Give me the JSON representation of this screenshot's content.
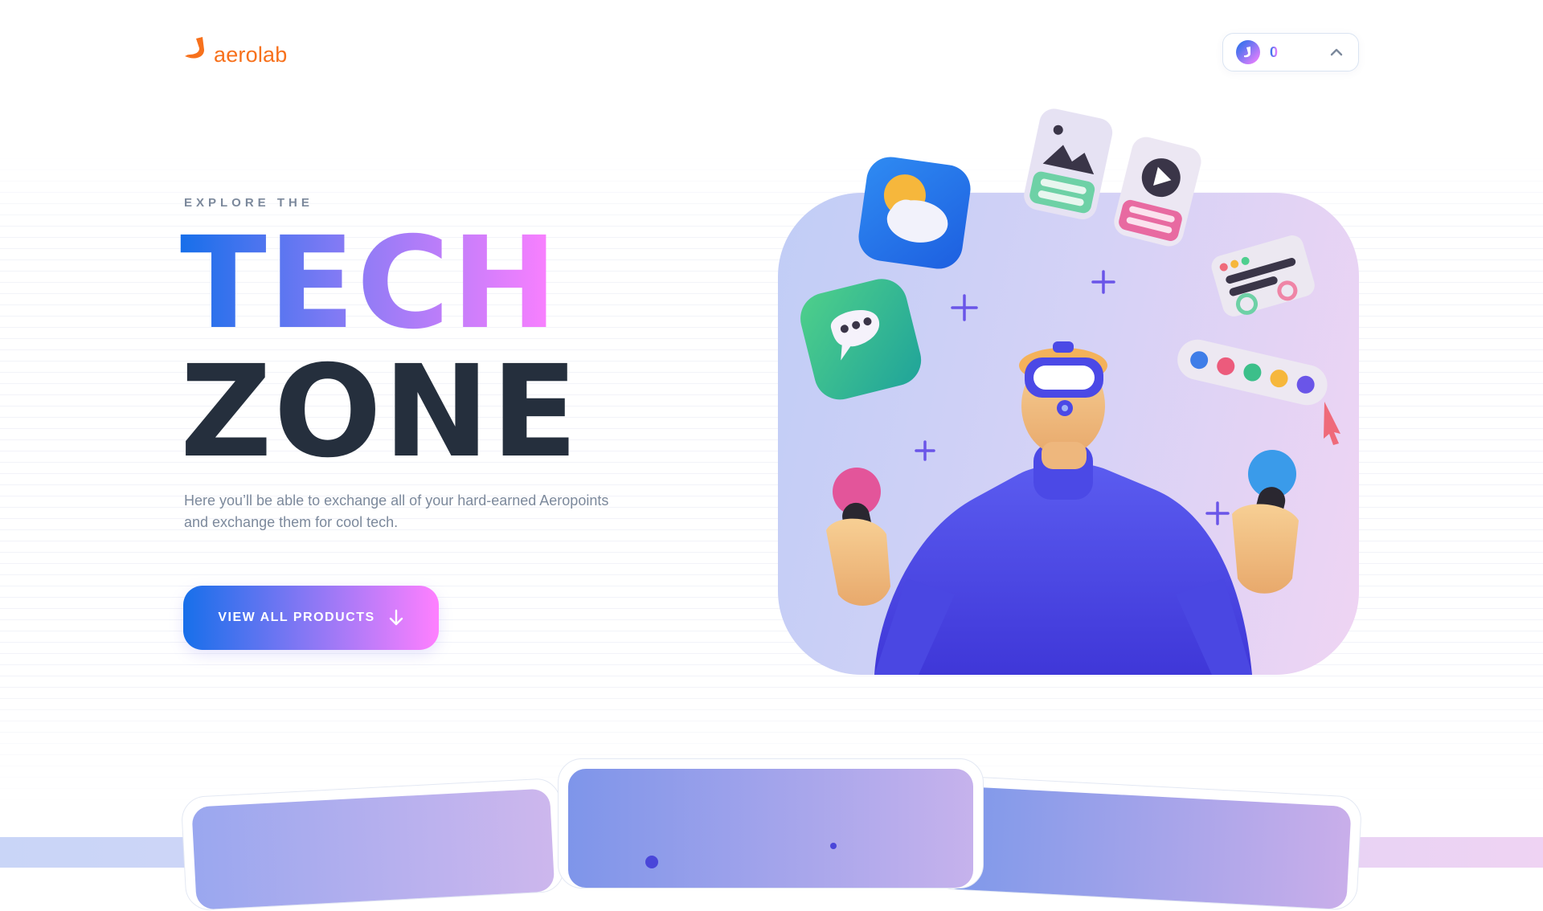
{
  "header": {
    "logo_text": "aerolab",
    "points_value": "0",
    "points_icon": "aeropay-coin-icon",
    "toggle_icon": "chevron-up-icon"
  },
  "hero": {
    "eyebrow": "EXPLORE THE",
    "title_line1": "TECH",
    "title_line2": "ZONE",
    "description": "Here you’ll be able to exchange all of your hard-earned Aeropoints and exchange them for cool tech.",
    "cta_label": "VIEW ALL PRODUCTS",
    "cta_icon": "arrow-down-icon",
    "illustration": "vr-person-illustration"
  },
  "colors": {
    "brand_orange": "#f7711c",
    "gradient_start": "#176fea",
    "gradient_end": "#ff80ff",
    "heading_dark": "#252f3d",
    "text_muted": "#7c899c"
  }
}
